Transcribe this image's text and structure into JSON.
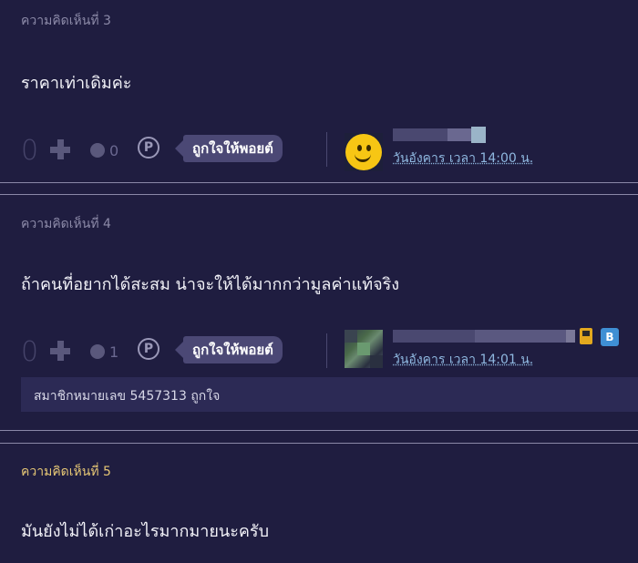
{
  "comments": [
    {
      "header": "ความคิดเห็นที่ 3",
      "body": "ราคาเท่าเดิมค่ะ",
      "vote_count": "0",
      "emotion_count": "0",
      "like_label": "ถูกใจให้พอยต์",
      "date": "วันอังคาร เวลา 14:00 น."
    },
    {
      "header": "ความคิดเห็นที่ 4",
      "body": "ถ้าคนที่อยากได้สะสม น่าจะให้ได้มากกว่ามูลค่าแท้จริง",
      "vote_count": "0",
      "emotion_count": "1",
      "like_label": "ถูกใจให้พอยต์",
      "date": "วันอังคาร เวลา 14:01 น.",
      "liked_by": "สมาชิกหมายเลข 5457313 ถูกใจ"
    },
    {
      "header": "ความคิดเห็นที่ 5",
      "body": "มันยังไม่ได้เก่าอะไรมากมายนะครับ"
    }
  ],
  "icons": {
    "plus": "plus-icon",
    "emotion": "emotion-icon",
    "point": "point-icon"
  },
  "colors": {
    "background": "#1f1d40",
    "like_button": "#4b4875",
    "link": "#8fb8e0",
    "highlight_header": "#e6c775"
  }
}
